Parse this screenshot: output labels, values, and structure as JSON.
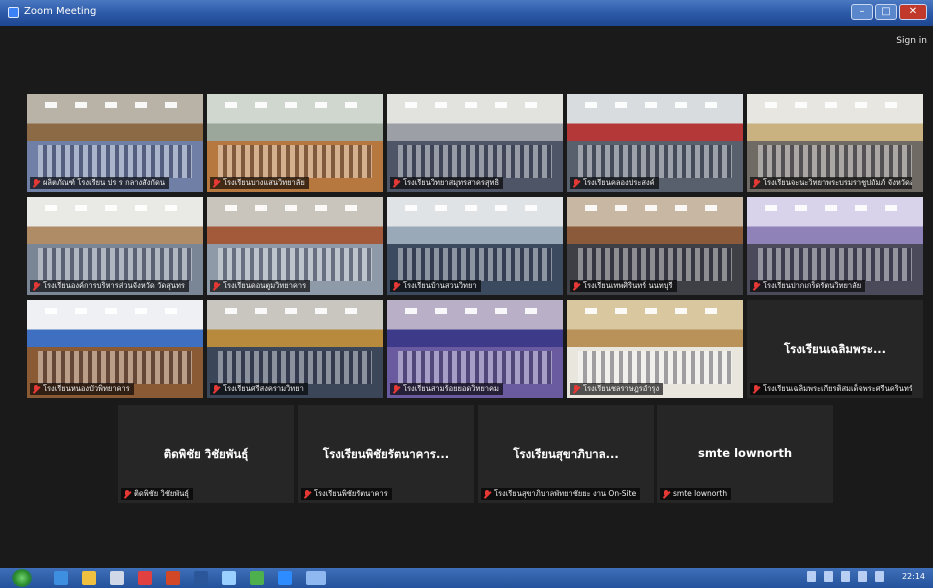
{
  "window": {
    "title": "Zoom Meeting",
    "sign_in": "Sign in",
    "controls": [
      "minimize",
      "maximize",
      "close"
    ]
  },
  "video_tiles": [
    {
      "name": "ผลิตภัณฑ์ โรงเรียน ปร ร กลางสังกัดน",
      "scene": "hall-wood"
    },
    {
      "name": "โรงเรียนบางแสนวิทยาลัย",
      "scene": "class-green"
    },
    {
      "name": "โรงเรียนวิทยาสมุทรสาครสุทธิ",
      "scene": "hall-crowd"
    },
    {
      "name": "โรงเรียนคลองประสงค์",
      "scene": "class-red"
    },
    {
      "name": "โรงเรียนจะนะวิทยาพระบรมราชูปถัมภ์ จังหวัดสงขลา",
      "scene": "meeting-long"
    },
    {
      "name": "โรงเรียนองค์การบริหารส่วนจังหวัด วัดสุนทร",
      "scene": "hall-bright"
    },
    {
      "name": "โรงเรียนดอนตูมวิทยาคาร",
      "scene": "aud-wood"
    },
    {
      "name": "โรงเรียนบ้านสวนวิทยา",
      "scene": "class-blue"
    },
    {
      "name": "โรงเรียนเทพศิรินทร์ นนทบุรี",
      "scene": "hall-wood2"
    },
    {
      "name": "โรงเรียนปากเกร็ดรัตนวิทยาลัย",
      "scene": "hall-purple"
    },
    {
      "name": "โรงเรียนหนองบัวพิทยาคาร",
      "scene": "class-white"
    },
    {
      "name": "โรงเรียนศรีสงครามวิทยา",
      "scene": "class-dark"
    },
    {
      "name": "โรงเรียนสามร้อยยอดวิทยาคม",
      "scene": "aud-purple"
    },
    {
      "name": "โรงเรียนชลราษฎรอำรุง",
      "scene": "stage-gold",
      "active": true
    }
  ],
  "audio_tiles": [
    {
      "display": "โรงเรียนเฉลิมพระ...",
      "name": "โรงเรียนเฉลิมพระเกียรติสมเด็จพระศรีนครินทร์"
    },
    {
      "display": "ติดพิชัย วิชัยพันธุ์",
      "name": "ติดพิชัย วิชัยพันธุ์"
    },
    {
      "display": "โรงเรียนพิชัยรัตนาคาร...",
      "name": "โรงเรียนพิชัยรัตนาคาร"
    },
    {
      "display": "โรงเรียนสุขาภิบาล...",
      "name": "โรงเรียนสุขาภิบาลพัทยาชัยยะ งาน On-Site"
    },
    {
      "display": "smte lownorth",
      "name": "smte lownorth"
    }
  ],
  "taskbar": {
    "clock": "22:14"
  }
}
